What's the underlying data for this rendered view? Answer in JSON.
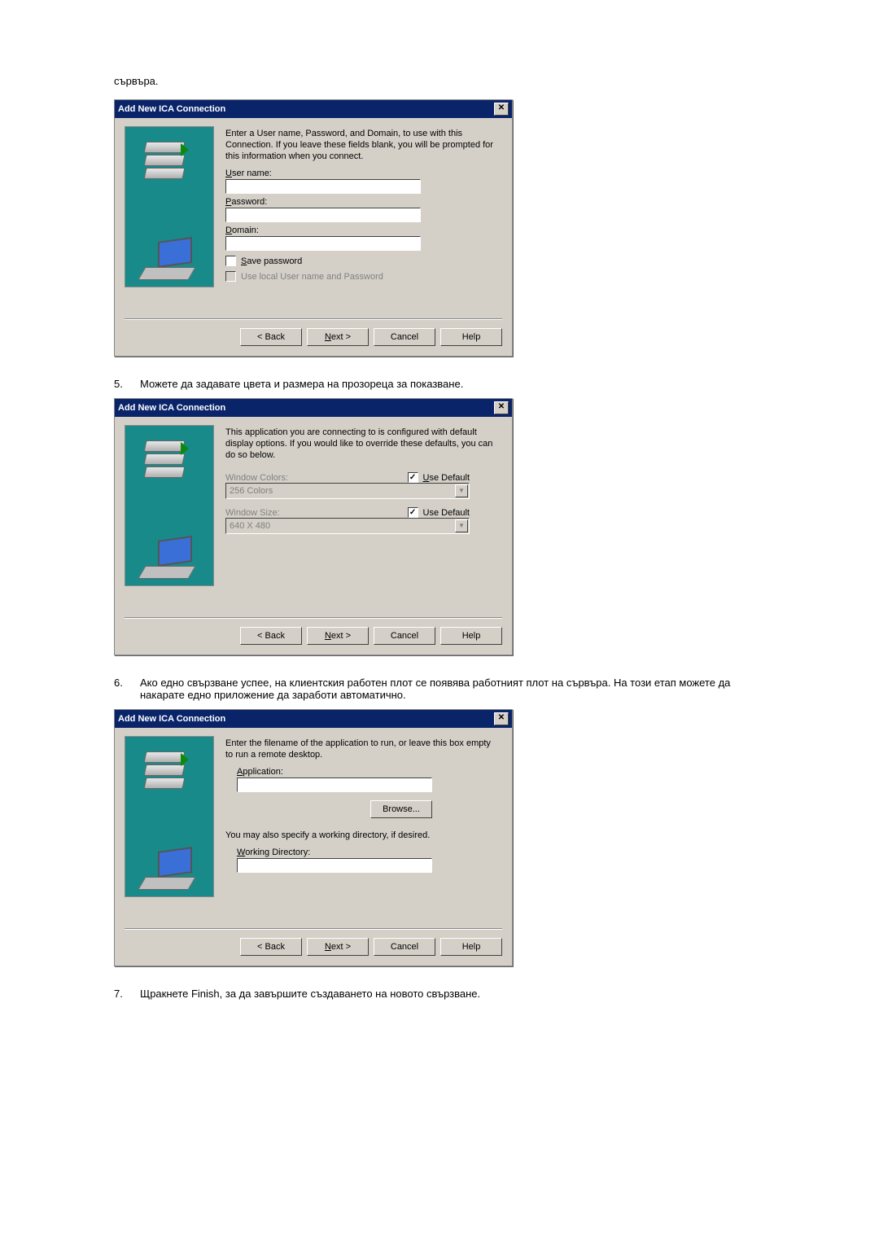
{
  "intro_text": "сървъра.",
  "dialog_title": "Add New ICA Connection",
  "buttons": {
    "back": "< Back",
    "next": "Next >",
    "cancel": "Cancel",
    "help": "Help",
    "browse": "Browse..."
  },
  "close_glyph": "✕",
  "step5": {
    "num": "5.",
    "text": "Можете да задавате цвета и размера на прозореца за показване."
  },
  "step6": {
    "num": "6.",
    "text": "Ако едно свързване успее, на клиентския работен плот се появява работният плот на сървъра. На този етап можете да накарате едно приложение да заработи автоматично."
  },
  "step7": {
    "num": "7.",
    "text": "Щракнете Finish, за да завършите създаването на новото свързване."
  },
  "dlg1": {
    "instruction": "Enter a User name, Password, and Domain, to use with this Connection.  If you leave these fields blank, you will be prompted for this information when you connect.",
    "user_label_u": "U",
    "user_label_rest": "ser name:",
    "pass_label_u": "P",
    "pass_label_rest": "assword:",
    "domain_label_u": "D",
    "domain_label_rest": "omain:",
    "save_pw_u": "S",
    "save_pw_rest": "ave password",
    "use_local": "Use local User name and Password"
  },
  "dlg2": {
    "instruction": "This application you are connecting to is configured with default display options.  If you would like to override these defaults, you can do so below.",
    "colors_label": "Window Colors:",
    "colors_value": "256 Colors",
    "size_label": "Window Size:",
    "size_value": "640 X 480",
    "use_default_u": "U",
    "use_default_rest": "se Default"
  },
  "dlg3": {
    "instruction": "Enter the filename of the application to run, or leave this box empty to run a remote desktop.",
    "app_label_u": "A",
    "app_label_rest": "pplication:",
    "wd_instruction": "You may also specify a working directory, if desired.",
    "wd_label_u": "W",
    "wd_label_rest": "orking Directory:"
  }
}
